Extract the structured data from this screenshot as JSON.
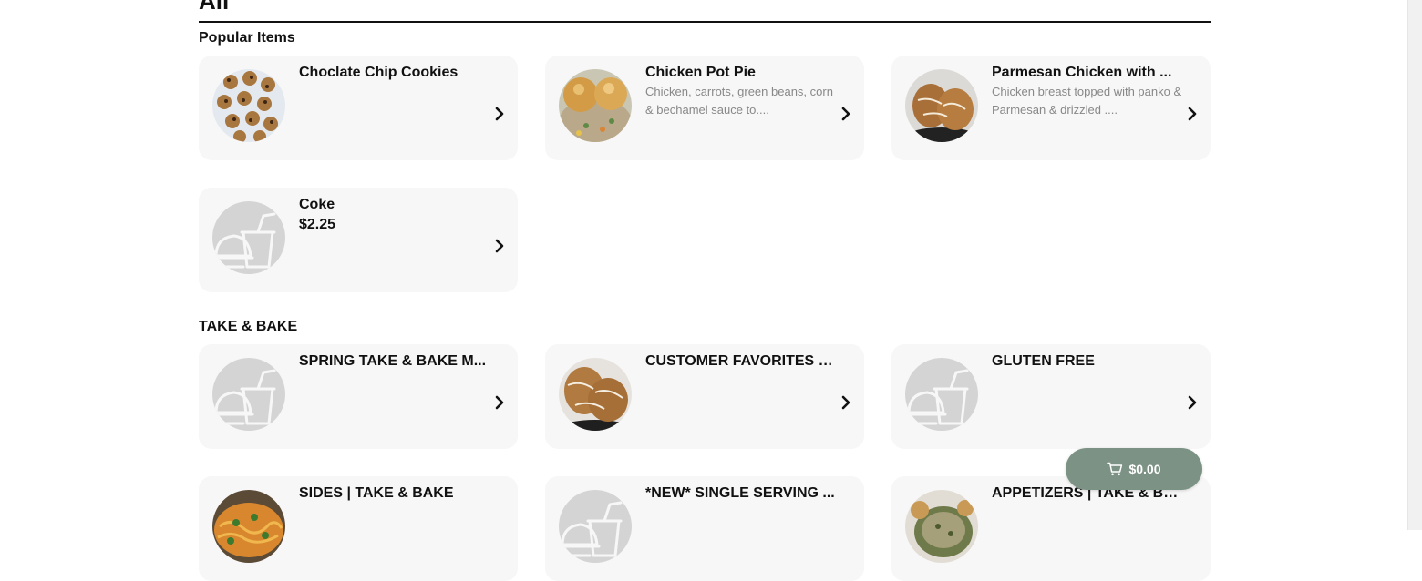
{
  "page": {
    "title": "All"
  },
  "sections": [
    {
      "title": "Popular Items"
    },
    {
      "title": "TAKE & BAKE"
    }
  ],
  "cards": {
    "cookies": {
      "name": "Choclate Chip Cookies"
    },
    "potpie": {
      "name": "Chicken Pot Pie",
      "desc": "Chicken, carrots, green beans, corn & bechamel sauce to...."
    },
    "parmesan": {
      "name": "Parmesan Chicken with ...",
      "desc": "Chicken breast topped with panko & Parmesan & drizzled ...."
    },
    "coke": {
      "name": "Coke",
      "price": "$2.25"
    },
    "spring": {
      "name": "SPRING TAKE & BAKE M..."
    },
    "favorites": {
      "name": "CUSTOMER FAVORITES T..."
    },
    "gluten": {
      "name": "GLUTEN FREE"
    },
    "sides": {
      "name": "SIDES | TAKE & BAKE"
    },
    "single": {
      "name": "*NEW* SINGLE SERVING ..."
    },
    "appetizers": {
      "name": "APPETIZERS | TAKE & BA..."
    }
  },
  "cart": {
    "total": "$0.00",
    "icon": "cart-icon"
  },
  "colors": {
    "cart_bg": "#7c9285",
    "card_bg": "#f7f7f7",
    "placeholder": "#d4d4d4"
  }
}
